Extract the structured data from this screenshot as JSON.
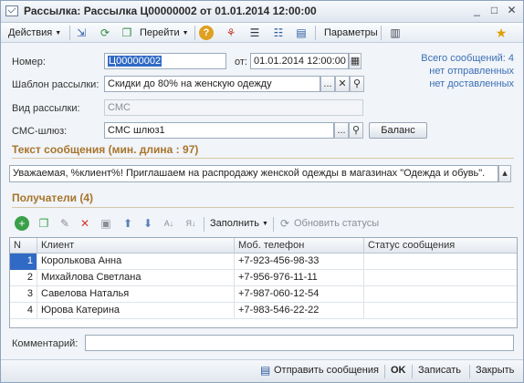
{
  "window": {
    "title": "Рассылка: Рассылка Ц00000002 от 01.01.2014 12:00:00",
    "controls": {
      "minimize": "_",
      "maximize": "□",
      "close": "✕"
    }
  },
  "toolbar": {
    "actions_label": "Действия",
    "goto_label": "Перейти",
    "params_label": "Параметры",
    "help_icon": "?"
  },
  "form": {
    "number_label": "Номер:",
    "number_value": "Ц00000002",
    "from_label": "от:",
    "date_value": "01.01.2014 12:00:00",
    "template_label": "Шаблон рассылки:",
    "template_value": "Скидки до 80% на женскую одежду",
    "type_label": "Вид рассылки:",
    "type_value": "СМС",
    "gateway_label": "СМС-шлюз:",
    "gateway_value": "СМС шлюз1",
    "balance_button": "Баланс",
    "ellipsis": "...",
    "clear_icon": "✕",
    "search_icon": "⚲"
  },
  "stats": {
    "total": "Всего сообщений: 4",
    "not_sent": "нет отправленных",
    "not_delivered": "нет доставленных"
  },
  "message": {
    "section_title": "Текст сообщения (мин. длина : 97)",
    "text": "Уважаемая, %клиент%! Приглашаем на распродажу женской одежды в магазинах \"Одежда и обувь\"."
  },
  "recipients": {
    "section_title": "Получатели (4)",
    "fill_label": "Заполнить",
    "refresh_label": "Обновить статусы",
    "columns": [
      "N",
      "Клиент",
      "Моб. телефон",
      "Статус сообщения"
    ],
    "rows": [
      {
        "n": "1",
        "client": "Королькова Анна",
        "phone": "+7-923-456-98-33",
        "status": ""
      },
      {
        "n": "2",
        "client": "Михайлова Светлана",
        "phone": "+7-956-976-11-11",
        "status": ""
      },
      {
        "n": "3",
        "client": "Савелова Наталья",
        "phone": "+7-987-060-12-54",
        "status": ""
      },
      {
        "n": "4",
        "client": "Юрова Катерина",
        "phone": "+7-983-546-22-22",
        "status": ""
      }
    ]
  },
  "comment": {
    "label": "Комментарий:",
    "value": ""
  },
  "footer": {
    "send_label": "Отправить сообщения",
    "ok_label": "OK",
    "save_label": "Записать",
    "close_label": "Закрыть"
  },
  "colors": {
    "section_title": "#a8752b",
    "link": "#3b6fb6",
    "selection": "#316ac5"
  }
}
